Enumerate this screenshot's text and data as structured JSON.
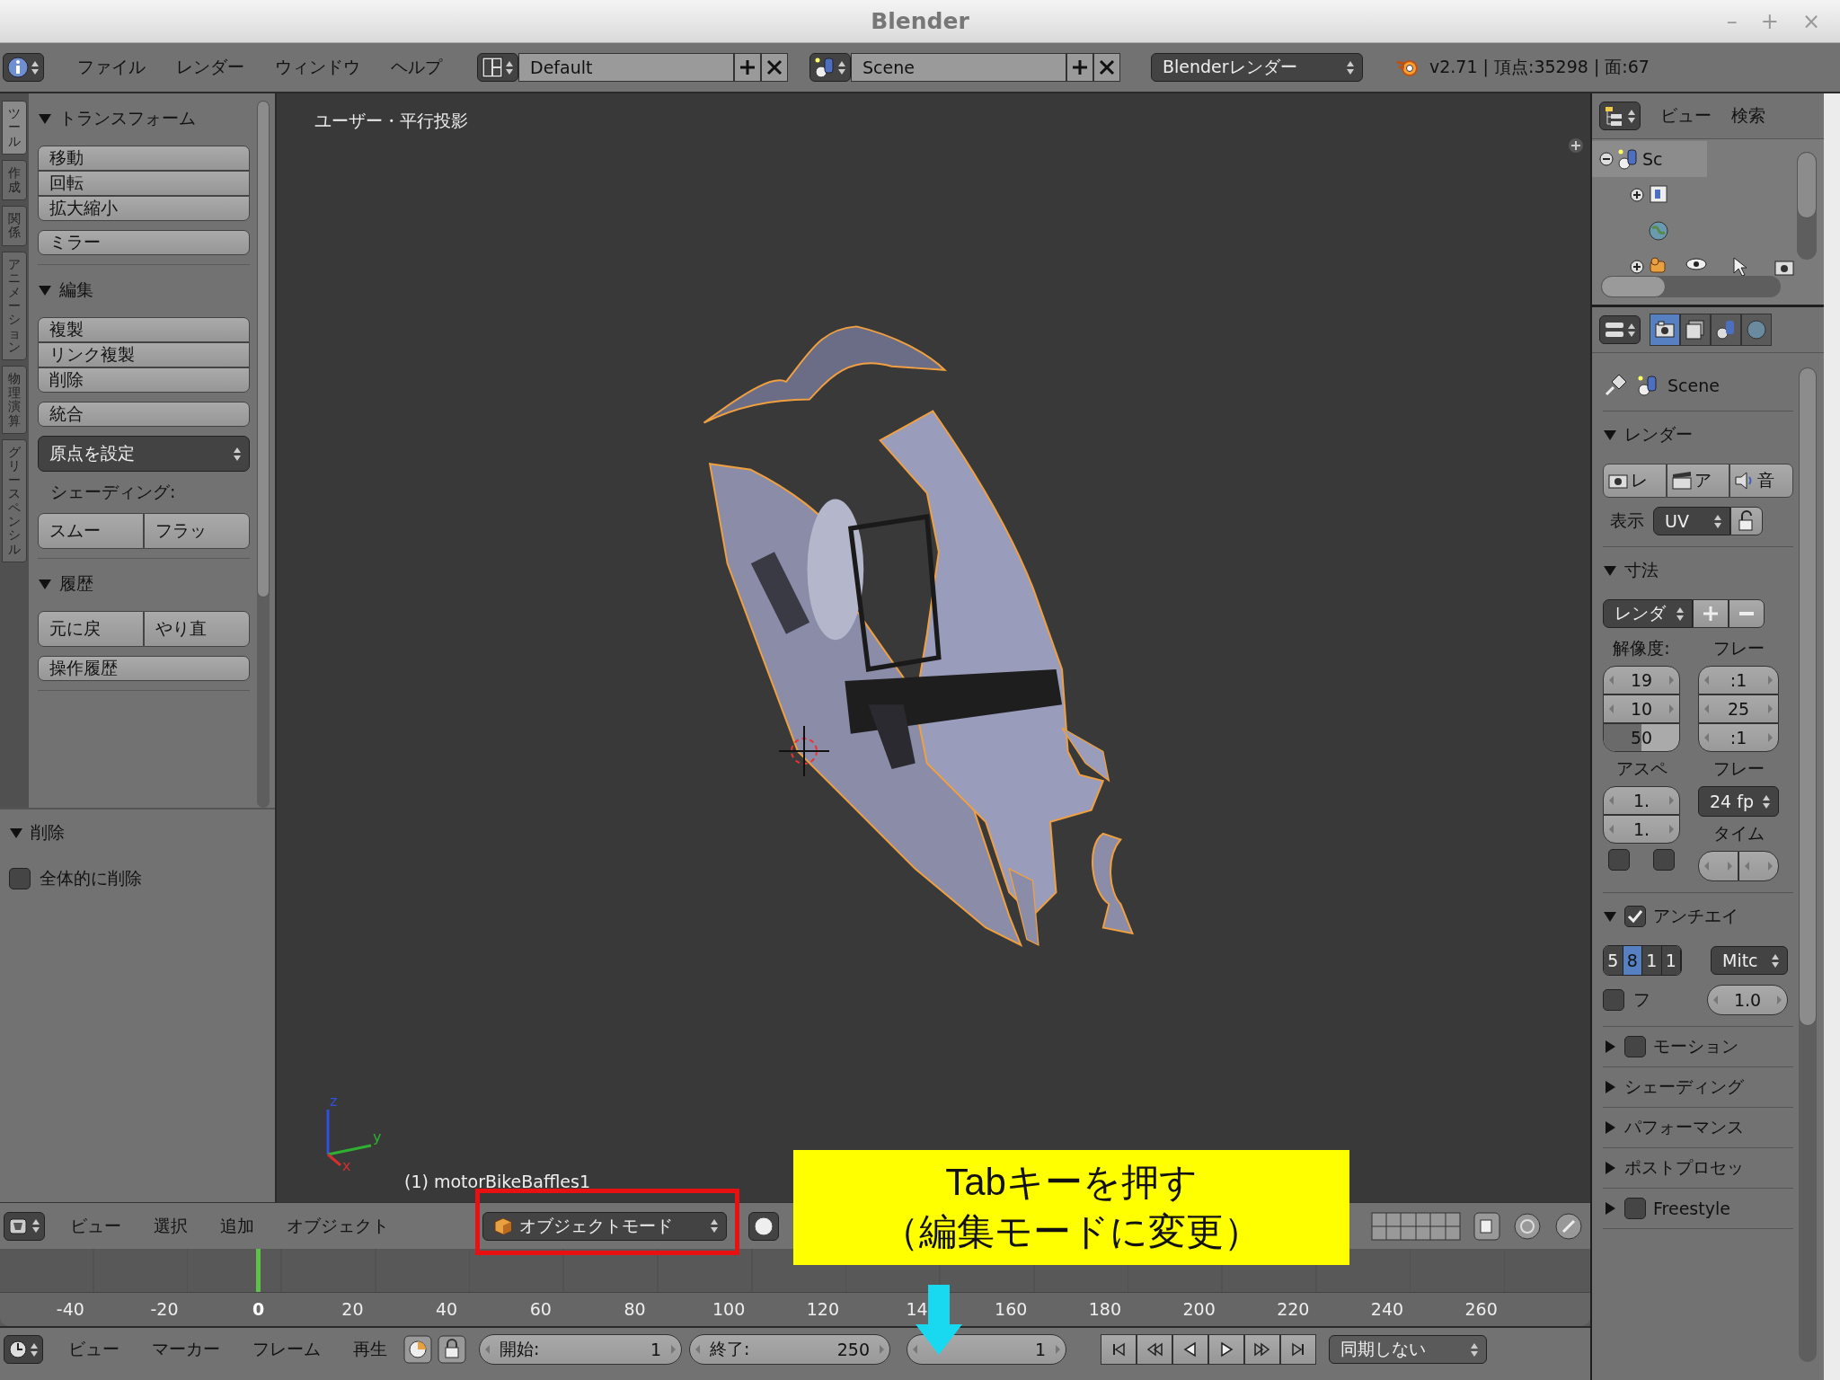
{
  "window": {
    "title": "Blender",
    "controls": [
      "–",
      "+",
      "×"
    ]
  },
  "top_bar": {
    "menus": [
      "ファイル",
      "レンダー",
      "ウィンドウ",
      "ヘルプ"
    ],
    "layout": "Default",
    "scene": "Scene",
    "engine": "Blenderレンダー",
    "stats": "v2.71 | 頂点:35298 | 面:67"
  },
  "tool_tabs": [
    {
      "label": "ツール",
      "selected": true
    },
    {
      "label": "作成",
      "selected": false
    },
    {
      "label": "関係",
      "selected": false
    },
    {
      "label": "アニメーション",
      "selected": false
    },
    {
      "label": "物理演算",
      "selected": false
    },
    {
      "label": "グリースペンシル",
      "selected": false
    }
  ],
  "tool_panel": {
    "sections": [
      {
        "title": "トランスフォーム",
        "expanded": true,
        "groups": [
          {
            "kind": "column",
            "buttons": [
              "移動",
              "回転",
              "拡大縮小"
            ]
          },
          {
            "kind": "column",
            "buttons": [
              "ミラー"
            ]
          }
        ]
      },
      {
        "title": "編集",
        "expanded": true,
        "groups": [
          {
            "kind": "column",
            "buttons": [
              "複製",
              "リンク複製",
              "削除"
            ]
          },
          {
            "kind": "column",
            "buttons": [
              "統合"
            ]
          },
          {
            "kind": "dropdown",
            "label": "原点を設定"
          },
          {
            "kind": "label",
            "label": "シェーディング:"
          },
          {
            "kind": "row",
            "buttons": [
              "スムー",
              "フラッ"
            ]
          }
        ]
      },
      {
        "title": "履歴",
        "expanded": true,
        "groups": [
          {
            "kind": "row",
            "buttons": [
              "元に戻",
              "やり直"
            ]
          },
          {
            "kind": "column",
            "buttons": [
              "操作履歴"
            ]
          }
        ]
      }
    ]
  },
  "operator_panel": {
    "title": "削除",
    "expanded": true,
    "options": [
      {
        "label": "全体的に削除",
        "checked": false
      }
    ]
  },
  "viewport": {
    "view_label": "ユーザー・平行投影",
    "object_label": "(1) motorBikeBaffles1",
    "axes": [
      "z",
      "y",
      "x"
    ]
  },
  "view3d_header": {
    "menus": [
      "ビュー",
      "選択",
      "追加",
      "オブジェクト"
    ],
    "mode": "オブジェクトモード"
  },
  "timeline": {
    "ruler": [
      {
        "label": "-40",
        "current": false
      },
      {
        "label": "-20",
        "current": false
      },
      {
        "label": "0",
        "current": true
      },
      {
        "label": "20",
        "current": false
      },
      {
        "label": "40",
        "current": false
      },
      {
        "label": "60",
        "current": false
      },
      {
        "label": "80",
        "current": false
      },
      {
        "label": "100",
        "current": false
      },
      {
        "label": "120",
        "current": false
      },
      {
        "label": "14",
        "current": false
      },
      {
        "label": "160",
        "current": false
      },
      {
        "label": "180",
        "current": false
      },
      {
        "label": "200",
        "current": false
      },
      {
        "label": "220",
        "current": false
      },
      {
        "label": "240",
        "current": false
      },
      {
        "label": "260",
        "current": false
      }
    ]
  },
  "timeline_header": {
    "menus": [
      "ビュー",
      "マーカー",
      "フレーム",
      "再生"
    ],
    "start_label": "開始:",
    "start": "1",
    "end_label": "終了:",
    "end": "250",
    "frame": "1",
    "sync": "同期しない"
  },
  "outliner": {
    "menus": [
      "ビュー",
      "検索"
    ],
    "tree": [
      {
        "label": "Sc",
        "expanded": true,
        "children": [
          {
            "kind": "collapsible"
          },
          {
            "kind": "leaf"
          },
          {
            "kind": "collapsible"
          }
        ]
      }
    ]
  },
  "properties": {
    "tabs": [
      {
        "kind": "render",
        "selected": true
      },
      {
        "kind": "layers",
        "selected": false
      },
      {
        "kind": "scene",
        "selected": false
      },
      {
        "kind": "world",
        "selected": false
      }
    ],
    "context": "Scene",
    "sections": [
      {
        "kind": "render",
        "title": "レンダー",
        "expanded": true,
        "buttons": [
          "レ",
          "ア",
          "音"
        ],
        "display_label": "表示",
        "display": "UV"
      },
      {
        "kind": "dimensions",
        "title": "寸法",
        "expanded": true,
        "preset": "レンダ",
        "res_label": "解像度:",
        "res": [
          "19",
          "10"
        ],
        "percent": {
          "label": "50",
          "level": 0.5
        },
        "aspect_label": "アスペ",
        "aspect": [
          "1.",
          "1."
        ],
        "toggles": [
          {
            "checked": false
          },
          {
            "checked": false
          }
        ],
        "frame_label": "フレー",
        "frames": [
          ":1",
          "25",
          ":1"
        ],
        "fps_label": "フレー",
        "fps": "24 fp",
        "time_label": "タイム"
      },
      {
        "kind": "antialias",
        "title": "アンチエイ",
        "expanded": true,
        "checked": true,
        "samples": [
          {
            "label": "5",
            "selected": false
          },
          {
            "label": "8",
            "selected": true
          },
          {
            "label": "1",
            "selected": false
          },
          {
            "label": "1",
            "selected": false
          }
        ],
        "filter": "Mitc",
        "full_label": "フ",
        "full_checked": false,
        "size": "1.0"
      },
      {
        "kind": "collapsed",
        "title": "モーション",
        "expanded": false,
        "checked": false
      },
      {
        "kind": "collapsed",
        "title": "シェーディング",
        "expanded": false
      },
      {
        "kind": "collapsed",
        "title": "パフォーマンス",
        "expanded": false
      },
      {
        "kind": "collapsed",
        "title": "ポストプロセッ",
        "expanded": false
      },
      {
        "kind": "collapsed",
        "title": "Freestyle",
        "expanded": false,
        "checked": false
      }
    ]
  },
  "annotations": [
    {
      "kind": "callout",
      "lines": [
        "Tabキーを押す",
        "（編集モードに変更）"
      ]
    },
    {
      "kind": "highlight"
    },
    {
      "kind": "arrow"
    }
  ]
}
